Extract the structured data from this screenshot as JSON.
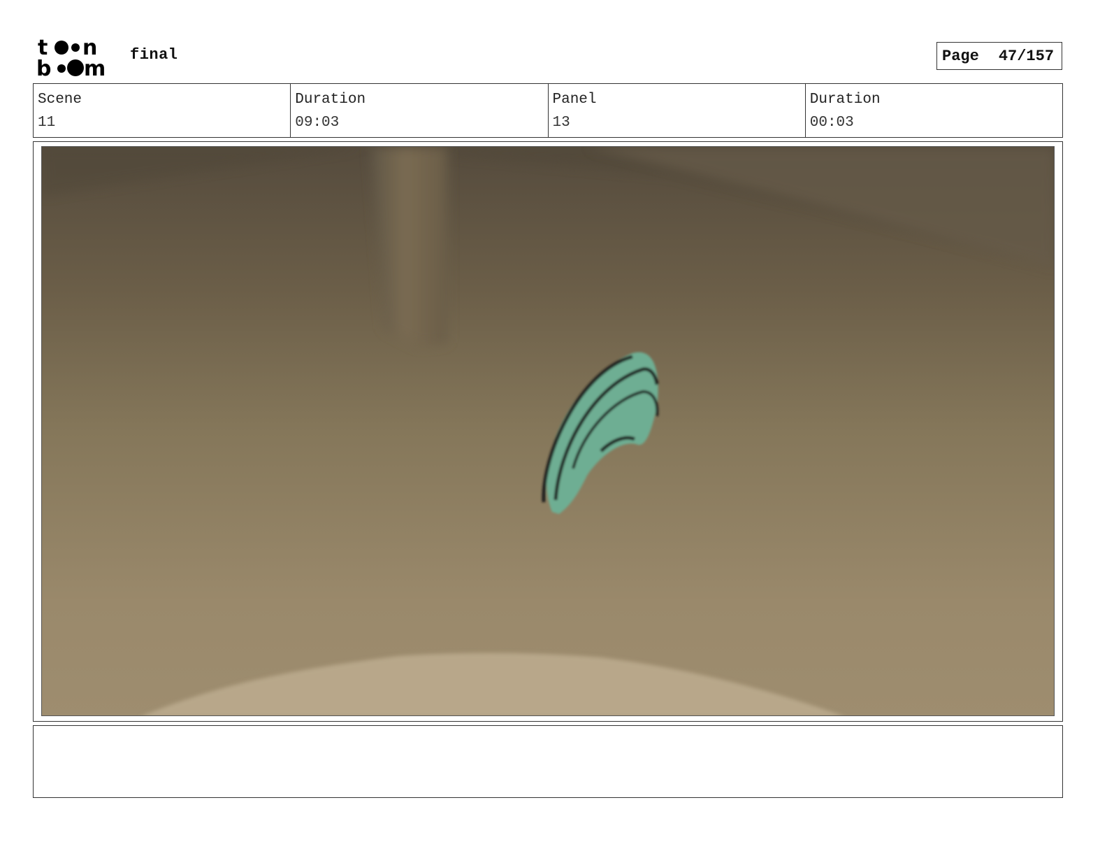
{
  "header": {
    "logo": {
      "icon": "toonboom-logo",
      "text": "toon boom"
    },
    "project_title": "final",
    "page_label": "Page",
    "page_number": "47/157"
  },
  "info": {
    "scene_label": "Scene",
    "scene_value": "11",
    "scene_duration_label": "Duration",
    "scene_duration_value": "09:03",
    "panel_label": "Panel",
    "panel_value": "13",
    "panel_duration_label": "Duration",
    "panel_duration_value": "00:03"
  },
  "panel": {
    "image": "blurred-room-with-green-crescent-object",
    "colors": {
      "wall_top": "#5a5040",
      "floor_mid": "#8a7a5c",
      "floor_bottom": "#9e8c6e",
      "foreground": "#b9a88c",
      "object": "#6fae92"
    }
  },
  "notes": {
    "text": ""
  }
}
